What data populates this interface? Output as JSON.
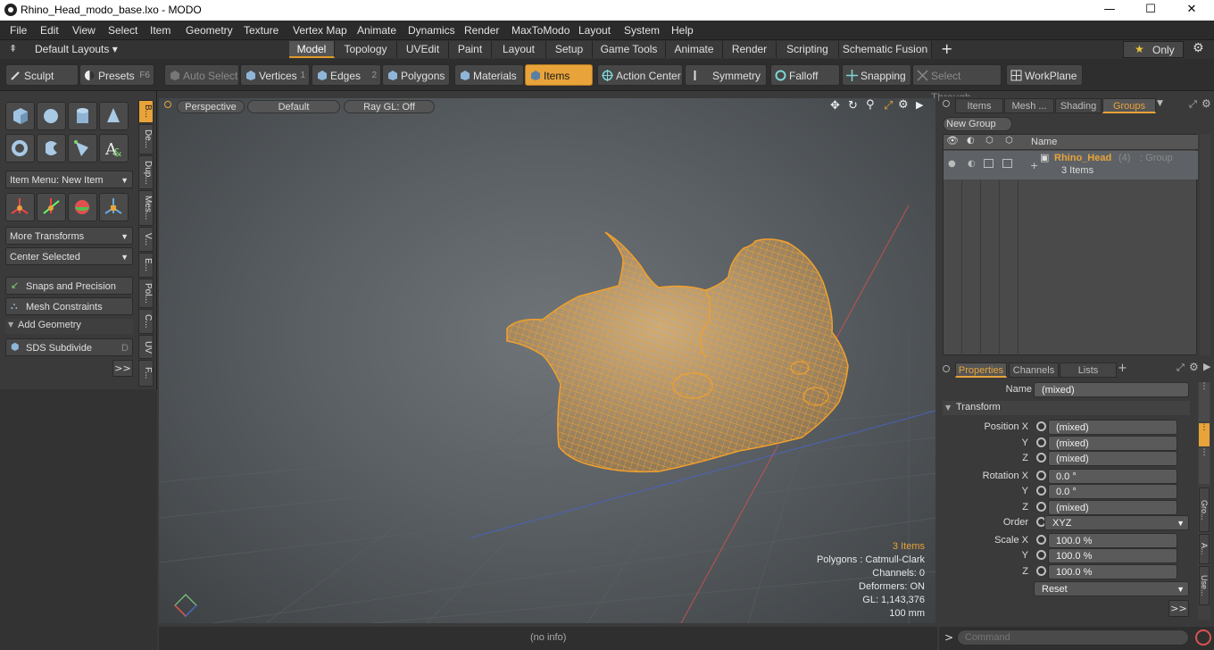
{
  "window": {
    "title": "Rhino_Head_modo_base.lxo - MODO",
    "minimize": "—",
    "maximize": "☐",
    "close": "✕"
  },
  "menu": [
    "File",
    "Edit",
    "View",
    "Select",
    "Item",
    "Geometry",
    "Texture",
    "Vertex Map",
    "Animate",
    "Dynamics",
    "Render",
    "MaxToModo",
    "Layout",
    "System",
    "Help"
  ],
  "layouts": {
    "default_label": "Default Layouts ▾",
    "tabs": [
      "Model",
      "Topology",
      "UVEdit",
      "Paint",
      "Layout",
      "Setup",
      "Game Tools",
      "Animate",
      "Render",
      "Scripting",
      "Schematic Fusion"
    ],
    "active_tab": "Model",
    "only_label": "Only",
    "plus": "+"
  },
  "toolbar": {
    "sculpt": "Sculpt",
    "presets": "Presets",
    "presets_key": "F6",
    "auto_select": "Auto Select",
    "vertices": "Vertices",
    "vertices_num": "1",
    "edges": "Edges",
    "edges_num": "2",
    "polygons": "Polygons",
    "materials": "Materials",
    "items": "Items",
    "action_center": "Action Center",
    "symmetry": "Symmetry",
    "falloff": "Falloff",
    "snapping": "Snapping",
    "select_through": "Select Through",
    "workplane": "WorkPlane"
  },
  "left": {
    "item_menu": "Item Menu: New Item",
    "more_transforms": "More Transforms",
    "center_selected": "Center Selected",
    "snaps": "Snaps and Precision",
    "mesh_constraints": "Mesh Constraints",
    "add_geometry": "Add Geometry",
    "sds_subdivide": "SDS Subdivide",
    "sds_key": "D",
    "more": ">>",
    "vtabs": [
      "B...",
      "De...",
      "Dup...",
      "Mes...",
      "V...",
      "E...",
      "Pol...",
      "C...",
      "UV",
      "F..."
    ]
  },
  "viewport": {
    "view": "Perspective",
    "shading": "Default",
    "raygl": "Ray GL: Off",
    "info": {
      "items": "3 Items",
      "polygons": "Polygons : Catmull-Clark",
      "channels": "Channels: 0",
      "deformers": "Deformers: ON",
      "gl": "GL: 1,143,376",
      "scale": "100 mm"
    }
  },
  "groups_panel": {
    "tabs": [
      "Items",
      "Mesh ...",
      "Shading",
      "Groups"
    ],
    "active_tab": "Groups",
    "new_group": "New Group",
    "col_name": "Name",
    "group_name": "Rhino_Head",
    "group_count": "(4)",
    "group_type": ": Group",
    "group_items": "3 Items"
  },
  "properties": {
    "tabs": [
      "Properties",
      "Channels",
      "Lists"
    ],
    "active_tab": "Properties",
    "name_label": "Name",
    "name_value": "(mixed)",
    "transform": "Transform",
    "position_label": "Position X",
    "position": [
      "(mixed)",
      "(mixed)",
      "(mixed)"
    ],
    "rotation_label": "Rotation X",
    "rotation": [
      "0.0 °",
      "0.0 °",
      "(mixed)"
    ],
    "order_label": "Order",
    "order_value": "XYZ",
    "scale_label": "Scale X",
    "scale": [
      "100.0 %",
      "100.0 %",
      "100.0 %"
    ],
    "y": "Y",
    "z": "Z",
    "reset": "Reset",
    "more": ">>",
    "side_tabs": [
      "Gro...",
      "A...",
      "Use..."
    ]
  },
  "status": {
    "info": "(no info)",
    "command_placeholder": "Command",
    "prompt": ">"
  },
  "colors": {
    "accent": "#e8a33a",
    "wire": "#f0a030"
  }
}
